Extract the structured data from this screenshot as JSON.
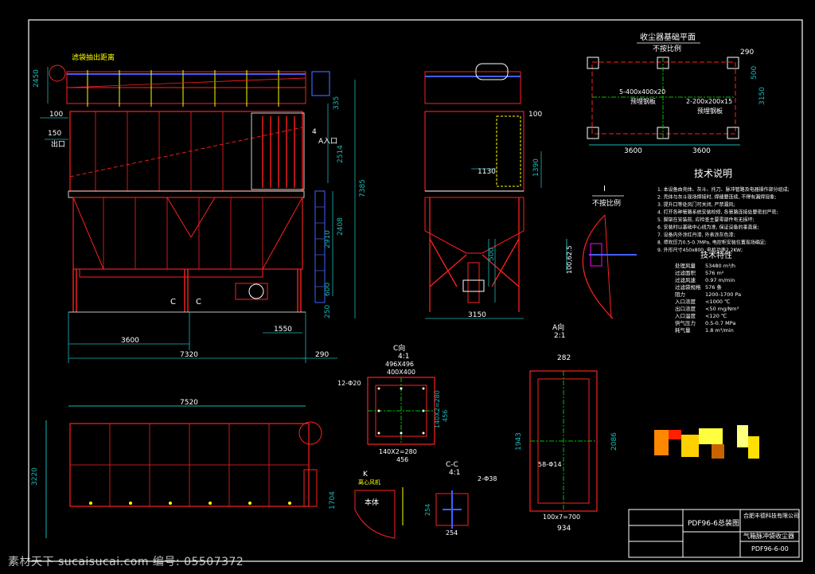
{
  "texts": {
    "filter_bag_pull": "滤袋抽出距离",
    "outlet": "出口",
    "inlet": "A入口",
    "section_c": "C",
    "foundation_title": "收尘器基础平面",
    "foundation_scale": "不按比例",
    "embed_1": "5-400x400x20",
    "embed_1b": "预埋钢板",
    "embed_2": "2-200x200x15",
    "embed_2b": "预埋钢板",
    "tech_title": "技术说明",
    "tech_lines": [
      "1. 本设备由壳体、灰斗、托刀、脉冲管路及电器操作部分组成;",
      "2. 壳体与灰斗现场焊接时, 焊缝要连续, 不得有漏焊现象;",
      "3. 提升口等处风门可关闭, 严禁漏风;",
      "4. 打开各种管路系统安装检修, 各管路连接处要密封严密;",
      "5. 脚架在安装前, 应检查主要零部件有无损坏;",
      "6. 安装时以基础中心线为准, 保证设备的垂直度;",
      "7. 设备内外涂红丹漆, 外表涂灰色漆;",
      "8. 喷吹压力0.5-0.7MPa, 电控柜安装位置现场确定;",
      "9. 外形尺寸450x800, 电机功率2.2KW;"
    ],
    "spec_title": "技术特性",
    "spec_rows": [
      [
        "处理风量",
        "53480 m³/h"
      ],
      [
        "过滤面积",
        "576 m²"
      ],
      [
        "过滤风速",
        "0.97 m/min"
      ],
      [
        "过滤袋规格",
        "576 条"
      ],
      [
        "阻力",
        "1200-1700 Pa"
      ],
      [
        "入口浓度",
        "<1000 ℃"
      ],
      [
        "出口浓度",
        "<50 mg/Nm³"
      ],
      [
        "入口温度",
        "<120 ℃"
      ],
      [
        "供气压力",
        "0.5-0.7 MPa"
      ],
      [
        "耗气量",
        "1.8 m³/min"
      ]
    ],
    "view_i": "I",
    "view_i_scale": "不按比例",
    "view_c": "C向",
    "view_c_scale": "4:1",
    "view_a": "A向",
    "view_a_scale": "2:1",
    "view_cc": "C-C",
    "view_cc_scale": "4:1",
    "view_k": "K",
    "view_k_sub": "离心风机",
    "body": "本体",
    "company": "合肥丰德科技有限公司",
    "drawing_name": "PDF96-6总装图",
    "product_name": "气箱脉冲袋收尘器",
    "drawing_no": "PDF96-6-00"
  },
  "dims": {
    "d2450": "2450",
    "d100": "100",
    "d150": "150",
    "d335": "335",
    "d4": "4",
    "d2514": "2514",
    "d7385": "7385",
    "d2910": "2910",
    "d2408": "2408",
    "d600": "600",
    "d250": "250",
    "d1550": "1550",
    "d3600a": "3600",
    "d7320": "7320",
    "d290": "290",
    "d1130": "1130",
    "d1390": "1390",
    "d3150": "3150",
    "d500": "500",
    "d7520": "7520",
    "d3220": "3220",
    "d1704": "1704",
    "d290f": "290",
    "d3150f": "3150",
    "d3600f1": "3600",
    "d3600f2": "3600",
    "d500f": "500",
    "d496": "496X496",
    "d400": "400X400",
    "d140": "140X2=280",
    "d140b": "140X2=280",
    "d456": "456",
    "d12": "12-Φ20",
    "d282": "282",
    "d1943": "1943",
    "d2086": "2086",
    "d934": "934",
    "d100x7": "100x7=700",
    "d58": "58-Φ14",
    "d254": "254",
    "d2phi": "2-Φ38"
  },
  "watermark": "素材天下 sucaisucai.com  编号: 05507372",
  "colors": {
    "background": "#000000",
    "frame": "#ffffff",
    "structure": "#ff2020",
    "dimension": "#19b8b8",
    "text_yellow": "#ffff00",
    "accent_blue": "#4060ff",
    "green": "#00c000",
    "magenta": "#ff00ff"
  }
}
